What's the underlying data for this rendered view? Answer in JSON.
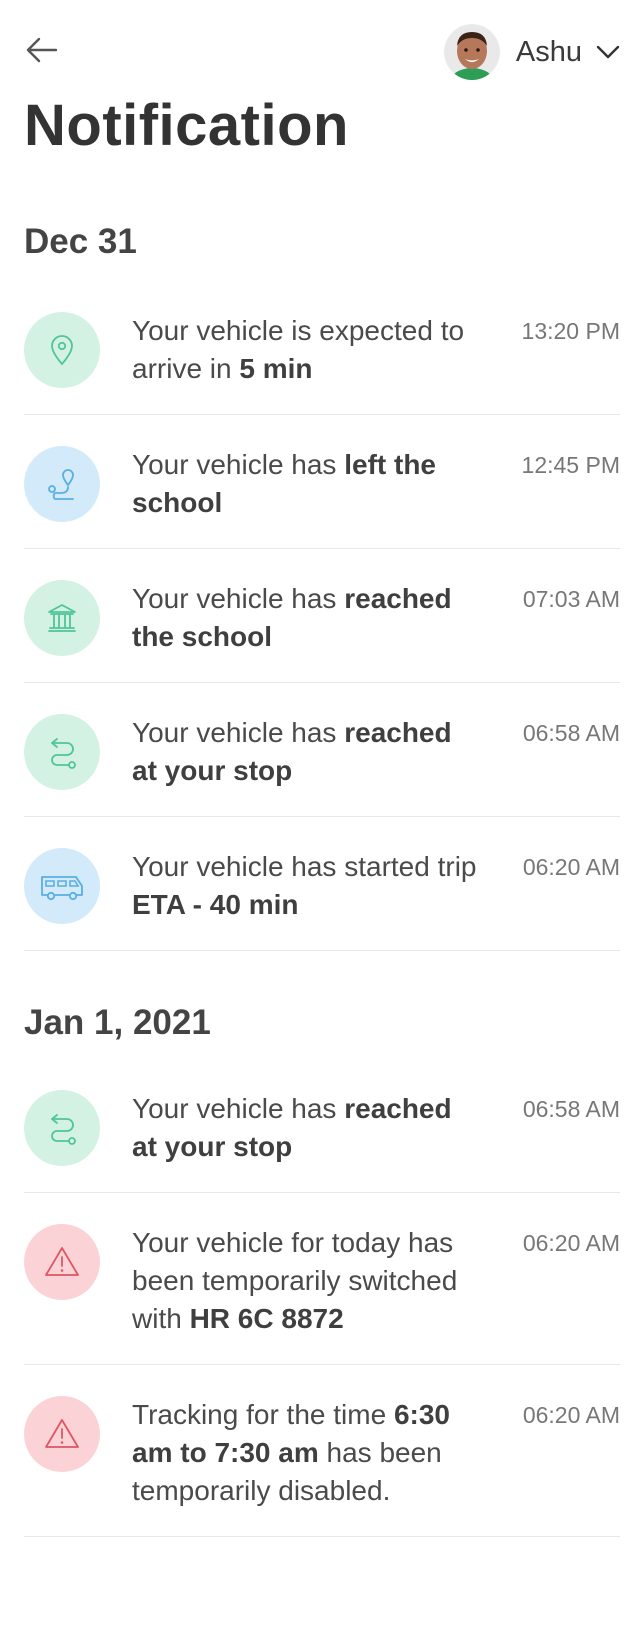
{
  "header": {
    "title": "Notification",
    "user_name": "Ashu"
  },
  "sections": [
    {
      "date": "Dec 31",
      "items": [
        {
          "pre": "Your vehicle is expected to arrive in ",
          "bold": "5 min",
          "post": "",
          "time": "13:20 PM",
          "icon": "location-pin-icon",
          "tone": "green"
        },
        {
          "pre": "Your vehicle has ",
          "bold": "left the school",
          "post": "",
          "time": "12:45 PM",
          "icon": "route-icon",
          "tone": "blue"
        },
        {
          "pre": "Your vehicle has ",
          "bold": "reached the school",
          "post": "",
          "time": "07:03 AM",
          "icon": "school-building-icon",
          "tone": "green"
        },
        {
          "pre": "Your vehicle has ",
          "bold": "reached at your stop",
          "post": "",
          "time": "06:58 AM",
          "icon": "stop-route-icon",
          "tone": "green"
        },
        {
          "pre": "Your vehicle has started trip ",
          "bold": "ETA - 40 min",
          "post": "",
          "time": "06:20 AM",
          "icon": "van-icon",
          "tone": "blue"
        }
      ]
    },
    {
      "date": "Jan 1, 2021",
      "items": [
        {
          "pre": "Your vehicle has ",
          "bold": "reached at your stop",
          "post": "",
          "time": "06:58 AM",
          "icon": "stop-route-icon",
          "tone": "green"
        },
        {
          "pre": "Your vehicle for today has been temporarily switched with ",
          "bold": "HR 6C 8872",
          "post": "",
          "time": "06:20 AM",
          "icon": "warning-icon",
          "tone": "red"
        },
        {
          "pre": "Tracking for the time ",
          "bold": "6:30 am to 7:30 am",
          "post": " has been temporarily disabled.",
          "time": "06:20 AM",
          "icon": "warning-icon",
          "tone": "red"
        }
      ]
    }
  ],
  "colors": {
    "green_bg": "#d4f2e3",
    "green_stroke": "#4fc598",
    "blue_bg": "#d2eaf9",
    "blue_stroke": "#5aaee3",
    "red_bg": "#fbd3d6",
    "red_stroke": "#e05563"
  }
}
